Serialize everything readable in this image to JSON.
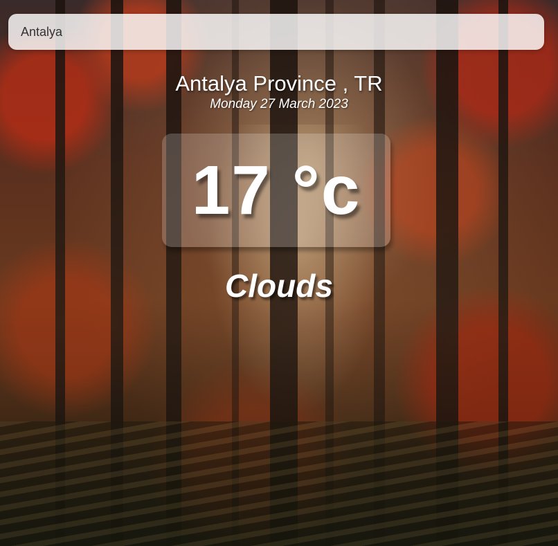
{
  "search": {
    "value": "Antalya"
  },
  "location": {
    "name": "Antalya Province , TR",
    "date": "Monday 27 March 2023"
  },
  "weather": {
    "temperature": "17 °c",
    "condition": "Clouds"
  }
}
